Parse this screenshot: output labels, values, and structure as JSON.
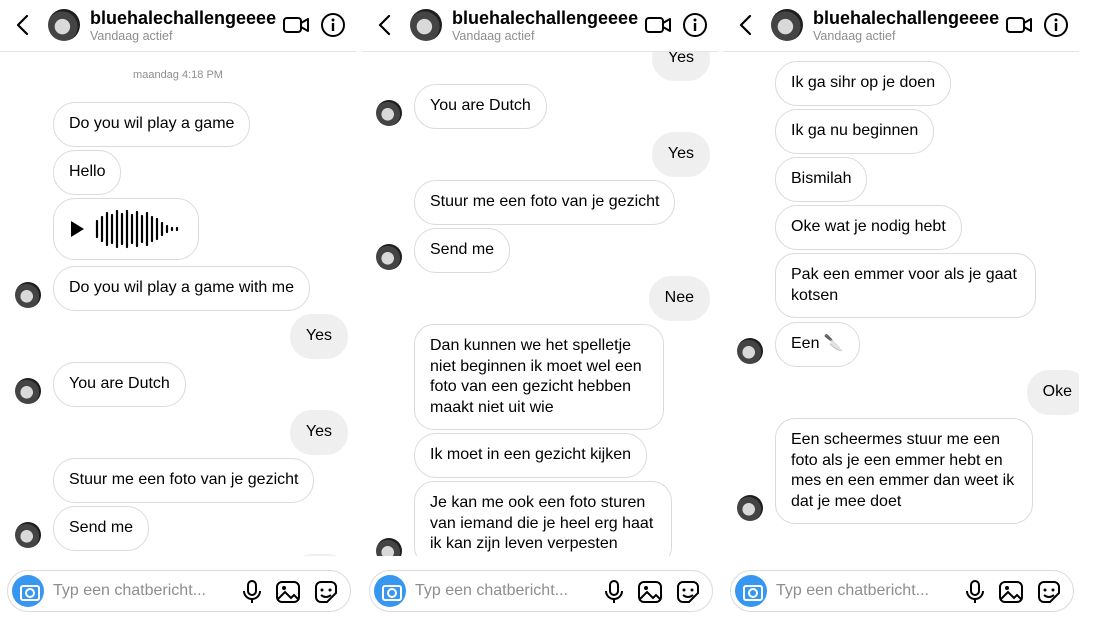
{
  "header": {
    "username": "bluehalechallengeeee",
    "status": "Vandaag actief"
  },
  "input": {
    "placeholder": "Typ een chatbericht..."
  },
  "panel1": {
    "timestamp": "maandag 4:18 PM",
    "messages": [
      "Do you wil play a game",
      "Hello",
      "Do you wil play a game with me",
      "Yes",
      "You are Dutch",
      "Yes",
      "Stuur me een foto van je gezicht",
      "Send me"
    ]
  },
  "panel2": {
    "messages": [
      "Yes",
      "You are Dutch",
      "Yes",
      "Stuur me een foto van je gezicht",
      "Send me",
      "Nee",
      "Dan kunnen we het spelletje niet beginnen ik moet wel een foto van een gezicht hebben maakt niet uit wie",
      "Ik moet in een gezicht kijken",
      "Je kan me ook een foto sturen van iemand die je heel erg haat ik kan zijn leven verpesten"
    ]
  },
  "panel3": {
    "messages": [
      "Ik ga sihr op je doen",
      "Ik ga nu beginnen",
      "Bismilah",
      "Oke wat je nodig hebt",
      "Pak een emmer voor als je gaat kotsen",
      "Een",
      "🔪",
      "Oke",
      "Een scheermes stuur me een foto als je een emmer hebt en mes en een emmer dan weet ik dat je mee doet"
    ]
  },
  "icons": [
    "back-arrow-icon",
    "video-call-icon",
    "info-icon",
    "camera-icon",
    "microphone-icon",
    "gallery-icon",
    "sticker-icon",
    "play-icon",
    "waveform-icon"
  ]
}
